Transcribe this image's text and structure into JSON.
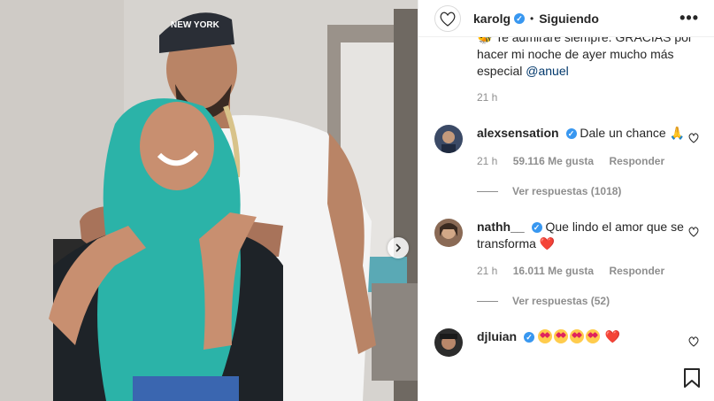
{
  "post": {
    "username": "karolg",
    "separator": "•",
    "follow_status": "Siguiendo",
    "more_label": "•••",
    "caption_text": "🐝 Te admiraré siempre. GRACIAS por hacer mi noche de ayer mucho más especial",
    "caption_mention": "@anuel",
    "caption_time": "21 h",
    "cap_hat_text": "NEW YORK"
  },
  "comments": [
    {
      "username": "alexsensation",
      "text": "Dale un chance 🙏",
      "time": "21 h",
      "likes": "59.116 Me gusta",
      "reply_label": "Responder",
      "view_replies": "Ver respuestas (1018)"
    },
    {
      "username": "nathh__",
      "text": "Que lindo el amor que se transforma ❤️",
      "time": "21 h",
      "likes": "16.011 Me gusta",
      "reply_label": "Responder",
      "view_replies": "Ver respuestas (52)"
    },
    {
      "username": "djluian",
      "text": "❤️"
    }
  ],
  "colors": {
    "verified": "#3897f0",
    "link": "#00376b",
    "muted": "#8e8e8e"
  }
}
